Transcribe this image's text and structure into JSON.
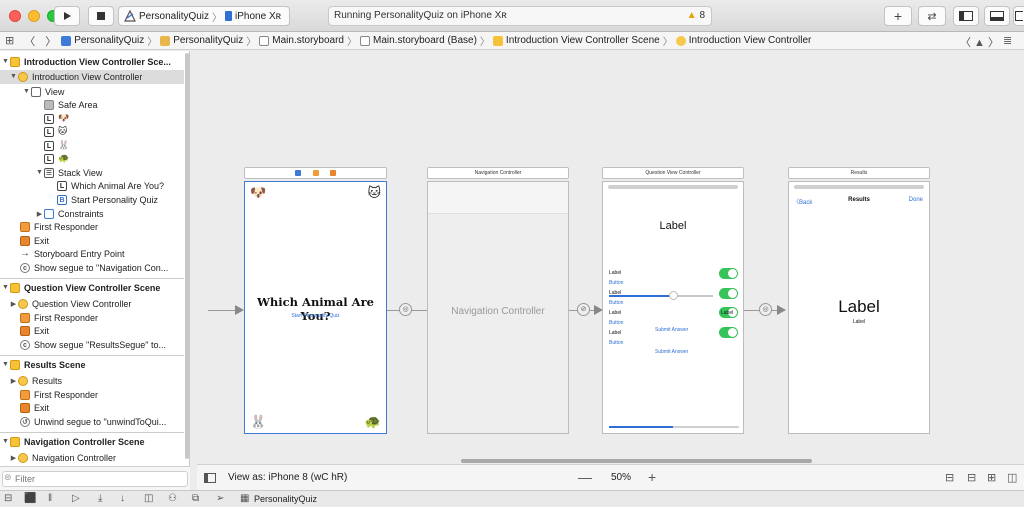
{
  "toolbar": {
    "scheme_target": "PersonalityQuiz",
    "scheme_device": "iPhone Xʀ",
    "status_text": "Running PersonalityQuiz on iPhone Xʀ",
    "warning_count": "8"
  },
  "jumpbar": {
    "crumbs": [
      "PersonalityQuiz",
      "PersonalityQuiz",
      "Main.storyboard",
      "Main.storyboard (Base)",
      "Introduction View Controller Scene",
      "Introduction View Controller"
    ]
  },
  "outline": {
    "intro_scene": "Introduction View Controller Sce...",
    "intro_vc": "Introduction View Controller",
    "view": "View",
    "safe_area": "Safe Area",
    "label_dog": "🐶",
    "label_cat": "🐱",
    "label_rabbit": "🐰",
    "label_turtle": "🐢",
    "stack_view": "Stack View",
    "stack_label": "Which Animal Are You?",
    "stack_button": "Start Personality Quiz",
    "constraints": "Constraints",
    "first_responder": "First Responder",
    "exit": "Exit",
    "entry_point": "Storyboard Entry Point",
    "show_segue_nav": "Show segue to \"Navigation Con...",
    "question_scene": "Question View Controller Scene",
    "question_vc": "Question View Controller",
    "show_segue_results": "Show segue \"ResultsSegue\" to...",
    "results_scene": "Results Scene",
    "results": "Results",
    "unwind_segue": "Unwind segue to \"unwindToQui...",
    "nav_scene": "Navigation Controller Scene",
    "nav_controller": "Navigation Controller",
    "filter_placeholder": "Filter"
  },
  "canvas": {
    "intro": {
      "emoji_tl": "🐶",
      "emoji_tr": "🐱",
      "emoji_bl": "🐰",
      "emoji_br": "🐢",
      "title": "Which Animal Are You?",
      "button": "Start Personality Quiz"
    },
    "nav": {
      "bar_title": "Navigation Controller",
      "body_label": "Navigation Controller"
    },
    "question": {
      "bar_title": "Question View Controller",
      "big_label": "Label",
      "row_label": "Label",
      "row_button": "Button",
      "submit": "Submit Answer"
    },
    "results": {
      "bar_title": "Results",
      "back": "Back",
      "title": "Results",
      "done": "Done",
      "big_label": "Label",
      "small_label": "Label"
    }
  },
  "canvas_bottom": {
    "view_as": "View as: iPhone 8 (wC hR)",
    "zoom": "50%"
  },
  "debugbar": {
    "target": "PersonalityQuiz"
  },
  "colors": {
    "accent": "#3e7ad6",
    "toggle_on": "#36c35a",
    "warning": "#e5a300"
  }
}
